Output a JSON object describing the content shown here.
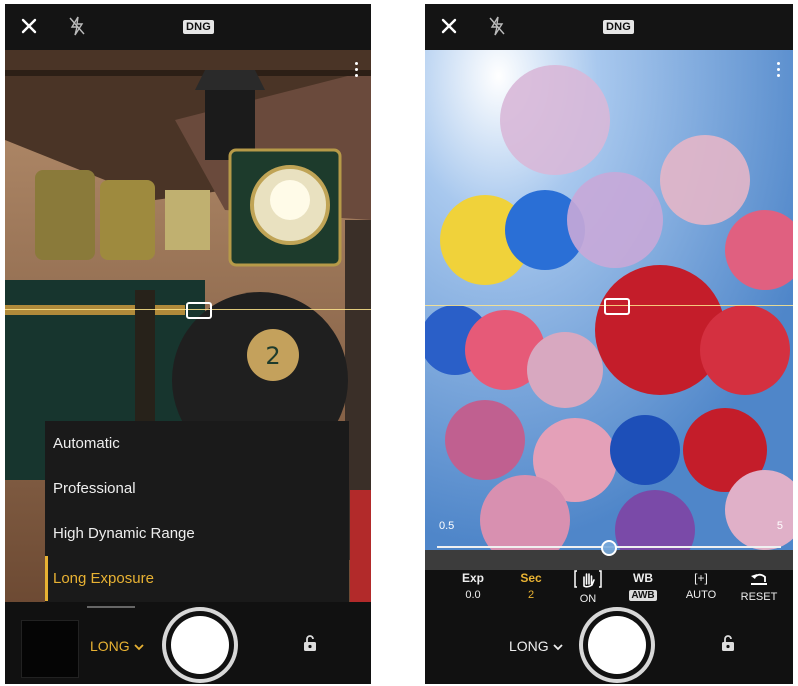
{
  "left_screen": {
    "top_bar": {
      "badge": "DNG"
    },
    "mode_menu": {
      "items": [
        "Automatic",
        "Professional",
        "High Dynamic Range",
        "Long Exposure"
      ],
      "selected": "Long Exposure"
    },
    "bottom_bar": {
      "mode_label": "LONG"
    }
  },
  "right_screen": {
    "top_bar": {
      "badge": "DNG"
    },
    "slider": {
      "min_label": "0.5",
      "max_label": "5",
      "value_fraction": 0.5
    },
    "controls": [
      {
        "label": "Exp",
        "value": "0.0"
      },
      {
        "label": "Sec",
        "value": "2"
      },
      {
        "label": "",
        "value": "ON"
      },
      {
        "label": "WB",
        "value": "AWB"
      },
      {
        "label": "[+]",
        "value": "AUTO"
      },
      {
        "label": "",
        "value": "RESET"
      }
    ],
    "bottom_bar": {
      "mode_label": "LONG"
    }
  },
  "colors": {
    "accent": "#e8b233",
    "bar_bg": "#111111"
  }
}
